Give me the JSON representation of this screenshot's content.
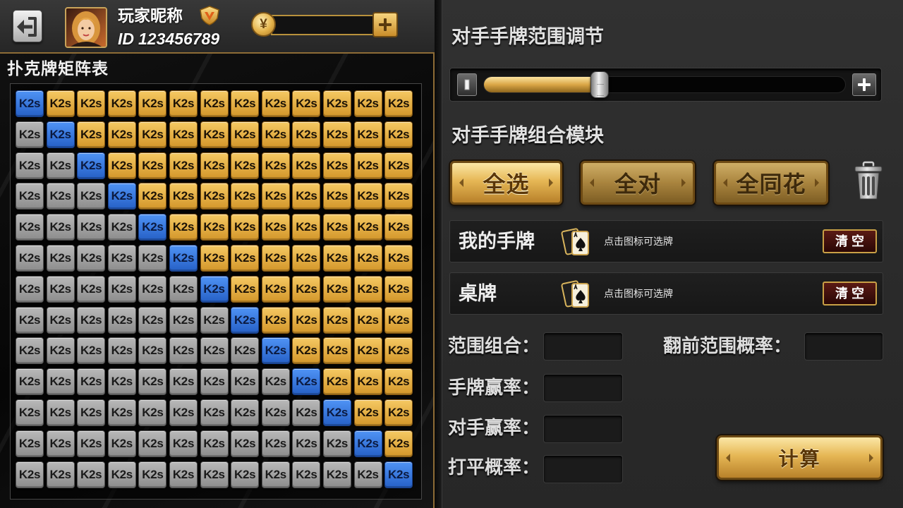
{
  "header": {
    "player_name": "玩家昵称",
    "id_prefix": "ID",
    "player_id": "123456789",
    "coin_symbol": "¥"
  },
  "icons": {
    "back": "logout-arrow-icon",
    "avatar": "player-avatar",
    "badge": "vip-badge-icon",
    "coin": "yuan-coin-icon",
    "add_coin": "plus-icon",
    "slider_min": "bar-icon",
    "slider_plus": "plus-icon",
    "trash": "trash-icon",
    "cards": "cards-icon"
  },
  "matrix": {
    "title": "扑克牌矩阵表",
    "cell_colors": {
      "gold": {
        "top": "#f5c963",
        "bottom": "#d3962a",
        "border": "#80530f",
        "text": "#1c1205"
      },
      "gray": {
        "top": "#b8b8b8",
        "bottom": "#8c8c8c",
        "border": "#4d4d4d",
        "text": "#1a1a1a"
      },
      "blue": {
        "top": "#4f93f5",
        "bottom": "#2660c6",
        "border": "#173f8c",
        "text": "#0b1a40"
      }
    },
    "rows": [
      [
        "K2s",
        "K2s",
        "K2s",
        "K2s",
        "K2s",
        "K2s",
        "K2s",
        "K2s",
        "K2s",
        "K2s",
        "K2s",
        "K2s",
        "K2s"
      ],
      [
        "K2s",
        "K2s",
        "K2s",
        "K2s",
        "K2s",
        "K2s",
        "K2s",
        "K2s",
        "K2s",
        "K2s",
        "K2s",
        "K2s",
        "K2s"
      ],
      [
        "K2s",
        "K2s",
        "K2s",
        "K2s",
        "K2s",
        "K2s",
        "K2s",
        "K2s",
        "K2s",
        "K2s",
        "K2s",
        "K2s",
        "K2s"
      ],
      [
        "K2s",
        "K2s",
        "K2s",
        "K2s",
        "K2s",
        "K2s",
        "K2s",
        "K2s",
        "K2s",
        "K2s",
        "K2s",
        "K2s",
        "K2s"
      ],
      [
        "K2s",
        "K2s",
        "K2s",
        "K2s",
        "K2s",
        "K2s",
        "K2s",
        "K2s",
        "K2s",
        "K2s",
        "K2s",
        "K2s",
        "K2s"
      ],
      [
        "K2s",
        "K2s",
        "K2s",
        "K2s",
        "K2s",
        "K2s",
        "K2s",
        "K2s",
        "K2s",
        "K2s",
        "K2s",
        "K2s",
        "K2s"
      ],
      [
        "K2s",
        "K2s",
        "K2s",
        "K2s",
        "K2s",
        "K2s",
        "K2s",
        "K2s",
        "K2s",
        "K2s",
        "K2s",
        "K2s",
        "K2s"
      ],
      [
        "K2s",
        "K2s",
        "K2s",
        "K2s",
        "K2s",
        "K2s",
        "K2s",
        "K2s",
        "K2s",
        "K2s",
        "K2s",
        "K2s",
        "K2s"
      ],
      [
        "K2s",
        "K2s",
        "K2s",
        "K2s",
        "K2s",
        "K2s",
        "K2s",
        "K2s",
        "K2s",
        "K2s",
        "K2s",
        "K2s",
        "K2s"
      ],
      [
        "K2s",
        "K2s",
        "K2s",
        "K2s",
        "K2s",
        "K2s",
        "K2s",
        "K2s",
        "K2s",
        "K2s",
        "K2s",
        "K2s",
        "K2s"
      ],
      [
        "K2s",
        "K2s",
        "K2s",
        "K2s",
        "K2s",
        "K2s",
        "K2s",
        "K2s",
        "K2s",
        "K2s",
        "K2s",
        "K2s",
        "K2s"
      ],
      [
        "K2s",
        "K2s",
        "K2s",
        "K2s",
        "K2s",
        "K2s",
        "K2s",
        "K2s",
        "K2s",
        "K2s",
        "K2s",
        "K2s",
        "K2s"
      ],
      [
        "K2s",
        "K2s",
        "K2s",
        "K2s",
        "K2s",
        "K2s",
        "K2s",
        "K2s",
        "K2s",
        "K2s",
        "K2s",
        "K2s",
        "K2s"
      ]
    ],
    "colors": [
      [
        "blue",
        "gold",
        "gold",
        "gold",
        "gold",
        "gold",
        "gold",
        "gold",
        "gold",
        "gold",
        "gold",
        "gold",
        "gold"
      ],
      [
        "gray",
        "blue",
        "gold",
        "gold",
        "gold",
        "gold",
        "gold",
        "gold",
        "gold",
        "gold",
        "gold",
        "gold",
        "gold"
      ],
      [
        "gray",
        "gray",
        "blue",
        "gold",
        "gold",
        "gold",
        "gold",
        "gold",
        "gold",
        "gold",
        "gold",
        "gold",
        "gold"
      ],
      [
        "gray",
        "gray",
        "gray",
        "blue",
        "gold",
        "gold",
        "gold",
        "gold",
        "gold",
        "gold",
        "gold",
        "gold",
        "gold"
      ],
      [
        "gray",
        "gray",
        "gray",
        "gray",
        "blue",
        "gold",
        "gold",
        "gold",
        "gold",
        "gold",
        "gold",
        "gold",
        "gold"
      ],
      [
        "gray",
        "gray",
        "gray",
        "gray",
        "gray",
        "blue",
        "gold",
        "gold",
        "gold",
        "gold",
        "gold",
        "gold",
        "gold"
      ],
      [
        "gray",
        "gray",
        "gray",
        "gray",
        "gray",
        "gray",
        "blue",
        "gold",
        "gold",
        "gold",
        "gold",
        "gold",
        "gold"
      ],
      [
        "gray",
        "gray",
        "gray",
        "gray",
        "gray",
        "gray",
        "gray",
        "blue",
        "gold",
        "gold",
        "gold",
        "gold",
        "gold"
      ],
      [
        "gray",
        "gray",
        "gray",
        "gray",
        "gray",
        "gray",
        "gray",
        "gray",
        "blue",
        "gold",
        "gold",
        "gold",
        "gold"
      ],
      [
        "gray",
        "gray",
        "gray",
        "gray",
        "gray",
        "gray",
        "gray",
        "gray",
        "gray",
        "blue",
        "gold",
        "gold",
        "gold"
      ],
      [
        "gray",
        "gray",
        "gray",
        "gray",
        "gray",
        "gray",
        "gray",
        "gray",
        "gray",
        "gray",
        "blue",
        "gold",
        "gold"
      ],
      [
        "gray",
        "gray",
        "gray",
        "gray",
        "gray",
        "gray",
        "gray",
        "gray",
        "gray",
        "gray",
        "gray",
        "blue",
        "gold"
      ],
      [
        "gray",
        "gray",
        "gray",
        "gray",
        "gray",
        "gray",
        "gray",
        "gray",
        "gray",
        "gray",
        "gray",
        "gray",
        "blue"
      ]
    ]
  },
  "range": {
    "title": "对手手牌范围调节",
    "value": 0.32
  },
  "combos": {
    "title": "对手手牌组合模块",
    "buttons": [
      {
        "label": "全选",
        "selected": true
      },
      {
        "label": "全对",
        "selected": false
      },
      {
        "label": "全同花",
        "selected": false
      }
    ]
  },
  "card_rows": [
    {
      "label": "我的手牌",
      "hint": "点击图标可选牌",
      "clear": "清 空"
    },
    {
      "label": "桌牌",
      "hint": "点击图标可选牌",
      "clear": "清 空"
    }
  ],
  "stats": {
    "range_combos": {
      "label": "范围组合：",
      "value": ""
    },
    "preflop_prob": {
      "label": "翻前范围概率：",
      "value": ""
    },
    "hand_win": {
      "label": "手牌赢率：",
      "value": ""
    },
    "opp_win": {
      "label": "对手赢率：",
      "value": ""
    },
    "tie_prob": {
      "label": "打平概率：",
      "value": ""
    }
  },
  "calculate_label": "计算",
  "colors": {
    "accent_gold": "#e6b755",
    "panel_border": "#8e6c36",
    "clear_button": "#5a1a14"
  }
}
